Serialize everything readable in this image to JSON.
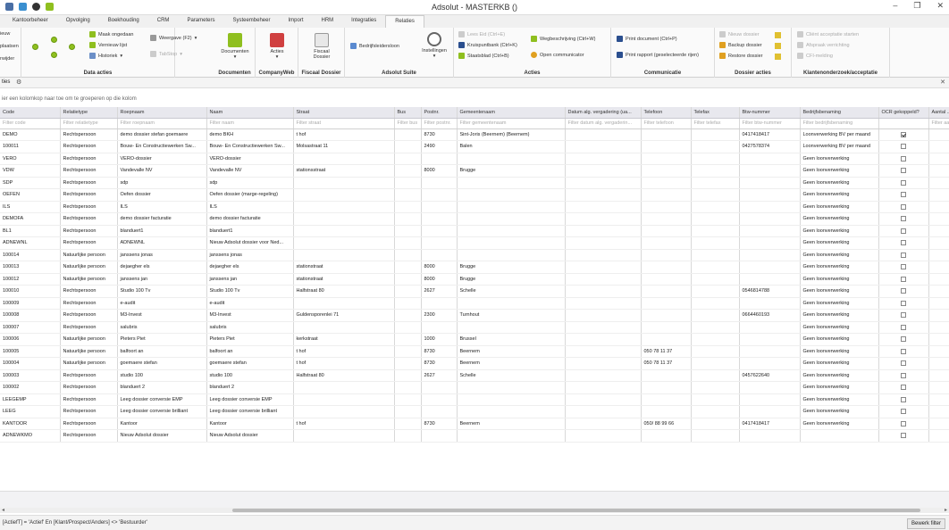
{
  "window": {
    "title": "Adsolut - MASTERKB ()"
  },
  "tabs": [
    "Kantoorbeheer",
    "Opvolging",
    "Boekhouding",
    "CRM",
    "Parameters",
    "Systeembeheer",
    "Import",
    "HRM",
    "Integraties",
    "Relaties"
  ],
  "ribbon": {
    "left_partial": [
      "ieuw",
      "plaatsen",
      "rwijder"
    ],
    "data_acties": {
      "label": "Data acties",
      "items": [
        "Maak ongedaan",
        "Vernieuw lijst",
        "Historiek"
      ],
      "weergave": "Weergave (F2)",
      "tabstop": "TabStop"
    },
    "documenten": {
      "label": "Documenten",
      "button": "Documenten"
    },
    "companyweb": {
      "label": "CompanyWeb",
      "button": "Acties"
    },
    "fiscaal": {
      "label": "Fiscaal Dossier",
      "button_line1": "Fiscaal",
      "button_line2": "Dossier"
    },
    "suite": {
      "label": "Adsolut Suite",
      "bedrijfsleidersloon": "Bedrijfsleidersloon",
      "instellingen": "Instellingen"
    },
    "acties": {
      "label": "Acties",
      "items": [
        "Lees Eid (Ctrl+E)",
        "Kruispuntbank (Ctrl+K)",
        "Staatsblad (Ctrl+B)",
        "Wegbeschrijving (Ctrl+W)",
        "Open communicator"
      ]
    },
    "communicatie": {
      "label": "Communicatie",
      "items": [
        "Print document (Ctrl+P)",
        "Print rapport (geselecteerde rijen)"
      ]
    },
    "dossier": {
      "label": "Dossier acties",
      "items": [
        "Nieuw dossier",
        "Backup dossier",
        "Restore dossier"
      ]
    },
    "klant": {
      "label": "Klantenonderzoek/acceptatie",
      "items": [
        "Cliënt acceptatie starten",
        "Afspraak verrichting",
        "CFI-melding"
      ]
    }
  },
  "doc_tab": {
    "label": "ties"
  },
  "group_hint": "ier een kolomkop naar toe om te groeperen op die kolom",
  "grid": {
    "columns": [
      "Code",
      "Relatietype",
      "Roepnaam",
      "Naam",
      "Straat",
      "Bus",
      "Postnr.",
      "Gemeentenaam",
      "Datum alg. vergadering (ua...",
      "Telefoon",
      "Telefax",
      "Btw-nummer",
      "Bedrijfsbenaming",
      "OCR gekoppeld?",
      "Aantal ..."
    ],
    "filters": [
      "Filter code",
      "Filter relatietype",
      "Filter roepnaam",
      "Filter naam",
      "Filter straat",
      "Filter bus",
      "Filter postnr.",
      "Filter gemeentenaam",
      "Filter datum alg. vergaderin...",
      "Filter telefoon",
      "Filter telefax",
      "Filter btw-nummer",
      "Filter bedrijfsbenaming",
      "",
      "Filter aa"
    ],
    "rows": [
      [
        "DEMO",
        "Rechtspersoon",
        "demo dossier stefan goemaere",
        "demo BKH",
        "t hof",
        "",
        "8730",
        "Sint-Joris (Beernem) (Beernem)",
        "",
        "",
        "",
        "0417418417",
        "Loonverwerking BV per maand",
        "1",
        ""
      ],
      [
        "100011",
        "Rechtspersoon",
        "Bouw- En Constructiewerken Sw...",
        "Bouw- En Constructiewerken Sw...",
        "Molsastraat 11",
        "",
        "2490",
        "Balen",
        "",
        "",
        "",
        "0427578374",
        "Loonverwerking BV per maand",
        "0",
        ""
      ],
      [
        "VERO",
        "Rechtspersoon",
        "VERO-dossier",
        "VERO-dossier",
        "",
        "",
        "",
        "",
        "",
        "",
        "",
        "",
        "Geen loonverwerking",
        "0",
        ""
      ],
      [
        "VDW",
        "Rechtspersoon",
        "Vandevalle NV",
        "Vandevalle NV",
        "stationsstraat",
        "",
        "8000",
        "Brugge",
        "",
        "",
        "",
        "",
        "Geen loonverwerking",
        "0",
        ""
      ],
      [
        "SDP",
        "Rechtspersoon",
        "sdp",
        "sdp",
        "",
        "",
        "",
        "",
        "",
        "",
        "",
        "",
        "Geen loonverwerking",
        "0",
        ""
      ],
      [
        "OEFEN",
        "Rechtspersoon",
        "Oefen dossier",
        "Oefen dossier (marge-regeling)",
        "",
        "",
        "",
        "",
        "",
        "",
        "",
        "",
        "Geen loonverwerking",
        "0",
        ""
      ],
      [
        "ILS",
        "Rechtspersoon",
        "ILS",
        "ILS",
        "",
        "",
        "",
        "",
        "",
        "",
        "",
        "",
        "Geen loonverwerking",
        "0",
        ""
      ],
      [
        "DEMOFA",
        "Rechtspersoon",
        "demo dossier facturatie",
        "demo dossier facturatie",
        "",
        "",
        "",
        "",
        "",
        "",
        "",
        "",
        "Geen loonverwerking",
        "0",
        ""
      ],
      [
        "BL1",
        "Rechtspersoon",
        "blanduert1",
        "blanduert1",
        "",
        "",
        "",
        "",
        "",
        "",
        "",
        "",
        "Geen loonverwerking",
        "0",
        ""
      ],
      [
        "ADNEWNL",
        "Rechtspersoon",
        "ADNEWNL",
        "Nieuw Adsolut dossier voor Ned...",
        "",
        "",
        "",
        "",
        "",
        "",
        "",
        "",
        "Geen loonverwerking",
        "0",
        ""
      ],
      [
        "100014",
        "Natuurlijke persoon",
        "janssens jonas",
        "janssens jonas",
        "",
        "",
        "",
        "",
        "",
        "",
        "",
        "",
        "Geen loonverwerking",
        "0",
        ""
      ],
      [
        "100013",
        "Natuurlijke persoon",
        "dejaegher els",
        "dejaegher els",
        "stationstraat",
        "",
        "8000",
        "Brugge",
        "",
        "",
        "",
        "",
        "Geen loonverwerking",
        "0",
        ""
      ],
      [
        "100012",
        "Natuurlijke persoon",
        "janssens jan",
        "janssens jan",
        "stationstraat",
        "",
        "8000",
        "Brugge",
        "",
        "",
        "",
        "",
        "Geen loonverwerking",
        "0",
        ""
      ],
      [
        "100010",
        "Rechtspersoon",
        "Studio 100 Tv",
        "Studio 100 Tv",
        "Halfstraat 80",
        "",
        "2627",
        "Schelle",
        "",
        "",
        "",
        "0546814788",
        "Geen loonverwerking",
        "0",
        ""
      ],
      [
        "100009",
        "Rechtspersoon",
        "e-audit",
        "e-audit",
        "",
        "",
        "",
        "",
        "",
        "",
        "",
        "",
        "Geen loonverwerking",
        "0",
        ""
      ],
      [
        "100008",
        "Rechtspersoon",
        "M3-Invest",
        "M3-Invest",
        "Guldensporenlei 71",
        "",
        "2300",
        "Turnhout",
        "",
        "",
        "",
        "0664460193",
        "Geen loonverwerking",
        "0",
        ""
      ],
      [
        "100007",
        "Rechtspersoon",
        "salubris",
        "salubris",
        "",
        "",
        "",
        "",
        "",
        "",
        "",
        "",
        "Geen loonverwerking",
        "0",
        ""
      ],
      [
        "100006",
        "Natuurlijke persoon",
        "Pieters Piet",
        "Pieters Piet",
        "kerkstraat",
        "",
        "1000",
        "Brussel",
        "",
        "",
        "",
        "",
        "Geen loonverwerking",
        "0",
        ""
      ],
      [
        "100005",
        "Natuurlijke persoon",
        "balfoort an",
        "balfoort an",
        "t hof",
        "",
        "8730",
        "Beernem",
        "",
        "050 78 11 37",
        "",
        "",
        "Geen loonverwerking",
        "0",
        ""
      ],
      [
        "100004",
        "Natuurlijke persoon",
        "goemaere stefan",
        "goemaere stefan",
        "t hof",
        "",
        "8730",
        "Beernem",
        "",
        "050 78 11 37",
        "",
        "",
        "Geen loonverwerking",
        "0",
        ""
      ],
      [
        "100003",
        "Rechtspersoon",
        "studio 100",
        "studio 100",
        "Halfstraat 80",
        "",
        "2627",
        "Schelle",
        "",
        "",
        "",
        "0457622640",
        "Geen loonverwerking",
        "0",
        ""
      ],
      [
        "100002",
        "Rechtspersoon",
        "blanduert 2",
        "blanduert 2",
        "",
        "",
        "",
        "",
        "",
        "",
        "",
        "",
        "Geen loonverwerking",
        "0",
        ""
      ],
      [
        "LEEGEMP",
        "Rechtspersoon",
        "Leeg dossier conversie EMP",
        "Leeg dossier conversie EMP",
        "",
        "",
        "",
        "",
        "",
        "",
        "",
        "",
        "Geen loonverwerking",
        "0",
        ""
      ],
      [
        "LEEG",
        "Rechtspersoon",
        "Leeg dossier conversie brilliant",
        "Leeg dossier conversie brilliant",
        "",
        "",
        "",
        "",
        "",
        "",
        "",
        "",
        "Geen loonverwerking",
        "0",
        ""
      ],
      [
        "KANTOOR",
        "Rechtspersoon",
        "Kantoor",
        "Kantoor",
        "t hof",
        "",
        "8730",
        "Beernem",
        "",
        "050/ 88 99 66",
        "",
        "0417418417",
        "Geen loonverwerking",
        "0",
        ""
      ],
      [
        "ADNEWKMO",
        "Rechtspersoon",
        "Nieuw Adsolut dossier",
        "Nieuw Adsolut dossier",
        "",
        "",
        "",
        "",
        "",
        "",
        "",
        "",
        "",
        "0",
        ""
      ]
    ]
  },
  "status": {
    "filter_text": "[ActiefT] = 'Actief' En [Klant/Prospect/Anders] <> 'Bestuurder'",
    "edit_filter": "Bewerk filter"
  }
}
